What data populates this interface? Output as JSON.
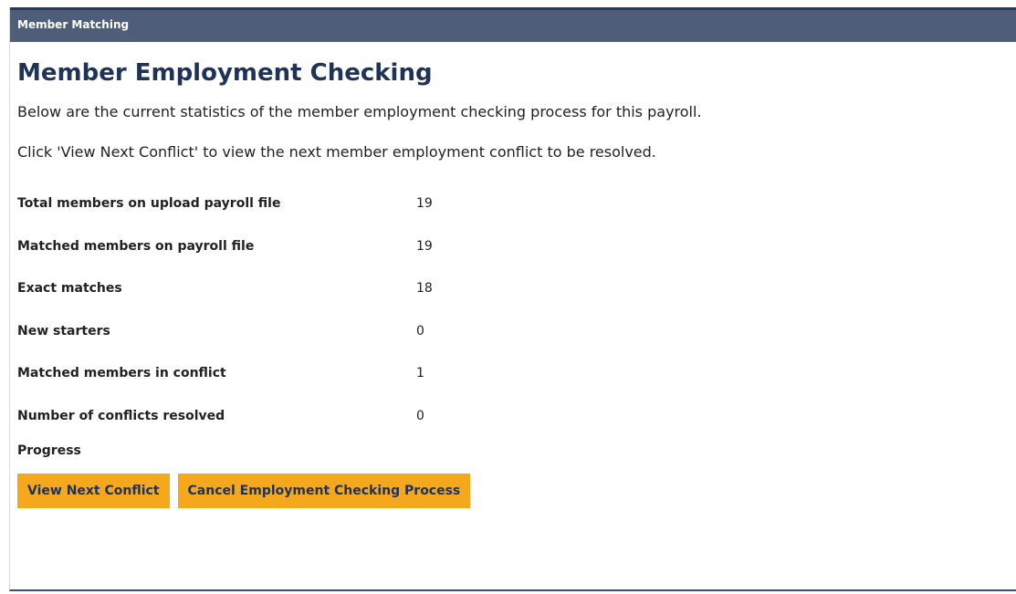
{
  "panel": {
    "header_title": "Member Matching"
  },
  "page": {
    "title": "Member Employment Checking",
    "intro": "Below are the current statistics of the member employment checking process for this payroll.",
    "instruction": "Click 'View Next Conflict' to view the next member employment conflict to be resolved."
  },
  "stats": [
    {
      "label": "Total members on upload payroll file",
      "value": "19"
    },
    {
      "label": "Matched members on payroll file",
      "value": "19"
    },
    {
      "label": "Exact matches",
      "value": "18"
    },
    {
      "label": "New starters",
      "value": "0"
    },
    {
      "label": "Matched members in conflict",
      "value": "1"
    },
    {
      "label": "Number of conflicts resolved",
      "value": "0"
    }
  ],
  "progress": {
    "label": "Progress"
  },
  "actions": {
    "view_next_label": "View Next Conflict",
    "cancel_label": "Cancel Employment Checking Process"
  },
  "colors": {
    "header_bg": "#4e5d7a",
    "title": "#1f3358",
    "button_bg": "#f5a81c"
  }
}
